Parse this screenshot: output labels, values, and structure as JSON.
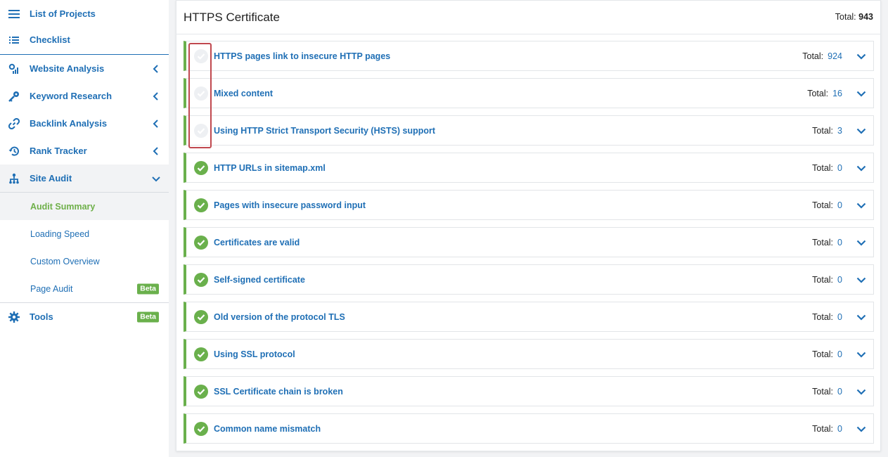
{
  "sidebar": {
    "items": [
      {
        "label": "List of Projects",
        "icon": "hamburger-icon"
      },
      {
        "label": "Checklist",
        "icon": "checklist-icon"
      },
      {
        "label": "Website Analysis",
        "icon": "analysis-icon"
      },
      {
        "label": "Keyword Research",
        "icon": "key-icon"
      },
      {
        "label": "Backlink Analysis",
        "icon": "link-icon"
      },
      {
        "label": "Rank Tracker",
        "icon": "history-icon"
      },
      {
        "label": "Site Audit",
        "icon": "sitemap-icon"
      },
      {
        "label": "Tools",
        "icon": "gear-icon"
      }
    ],
    "sub_items": [
      {
        "label": "Audit Summary"
      },
      {
        "label": "Loading Speed"
      },
      {
        "label": "Custom Overview"
      },
      {
        "label": "Page Audit"
      }
    ],
    "badge_beta": "Beta"
  },
  "main": {
    "title": "HTTPS Certificate",
    "total_label": "Total:",
    "total_value": "943",
    "rows": [
      {
        "label": "HTTPS pages link to insecure HTTP pages",
        "total_label": "Total:",
        "total": "924",
        "status": "pending"
      },
      {
        "label": "Mixed content",
        "total_label": "Total:",
        "total": "16",
        "status": "pending"
      },
      {
        "label": "Using HTTP Strict Transport Security (HSTS) support",
        "total_label": "Total:",
        "total": "3",
        "status": "pending"
      },
      {
        "label": "HTTP URLs in sitemap.xml",
        "total_label": "Total:",
        "total": "0",
        "status": "ok"
      },
      {
        "label": "Pages with insecure password input",
        "total_label": "Total:",
        "total": "0",
        "status": "ok"
      },
      {
        "label": "Certificates are valid",
        "total_label": "Total:",
        "total": "0",
        "status": "ok"
      },
      {
        "label": "Self-signed certificate",
        "total_label": "Total:",
        "total": "0",
        "status": "ok"
      },
      {
        "label": "Old version of the protocol TLS",
        "total_label": "Total:",
        "total": "0",
        "status": "ok"
      },
      {
        "label": "Using SSL protocol",
        "total_label": "Total:",
        "total": "0",
        "status": "ok"
      },
      {
        "label": "SSL Certificate chain is broken",
        "total_label": "Total:",
        "total": "0",
        "status": "ok"
      },
      {
        "label": "Common name mismatch",
        "total_label": "Total:",
        "total": "0",
        "status": "ok"
      }
    ]
  },
  "colors": {
    "link_blue": "#1f6fb5",
    "success_green": "#6ab04c",
    "active_green": "#6fb04a",
    "highlight_red": "#c0484f",
    "pending_gray": "#eef0f3"
  }
}
